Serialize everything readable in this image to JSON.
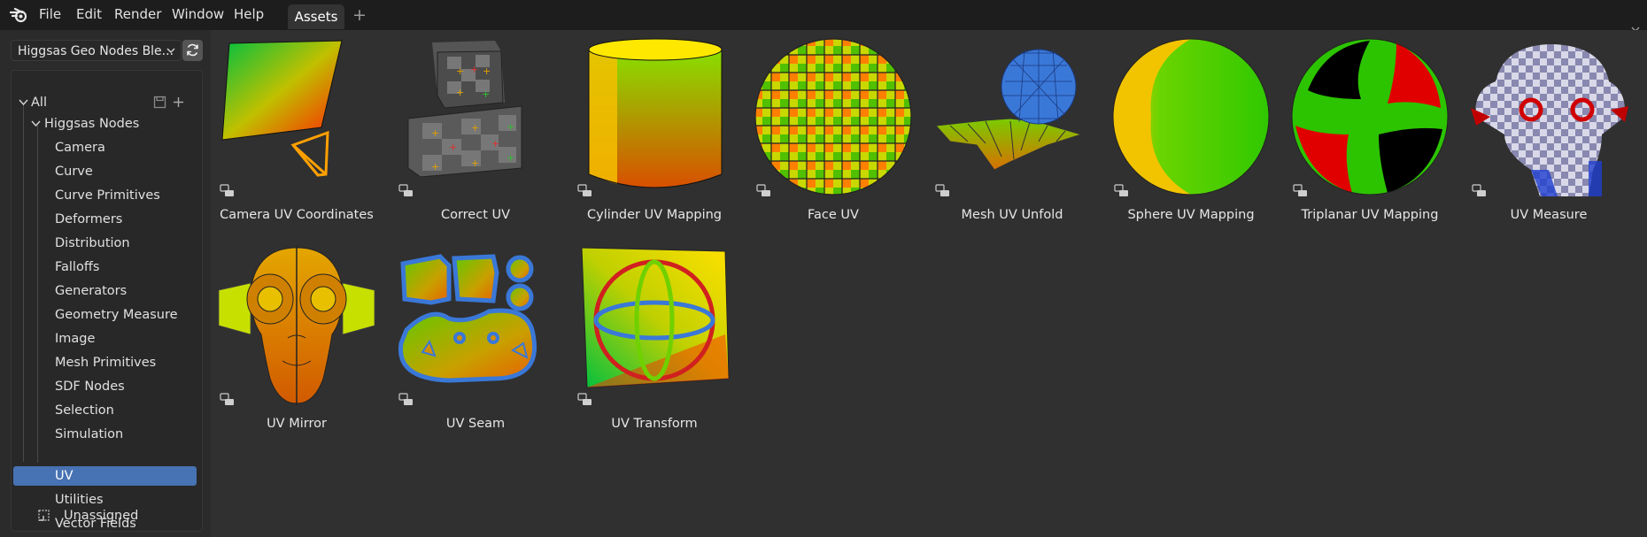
{
  "menubar": {
    "logo_icon": "blender-logo-icon",
    "items": [
      "File",
      "Edit",
      "Render",
      "Window",
      "Help"
    ],
    "tabs": [
      {
        "label": "Assets",
        "active": true
      }
    ],
    "add_tab_label": "+"
  },
  "sidebar": {
    "library_selector": {
      "value": "Higgsas Geo Nodes Ble..."
    },
    "refresh_icon": "refresh-icon",
    "tree": {
      "root": {
        "label": "All"
      },
      "group": {
        "label": "Higgsas Nodes"
      },
      "items": [
        {
          "label": "Camera"
        },
        {
          "label": "Curve"
        },
        {
          "label": "Curve Primitives"
        },
        {
          "label": "Deformers"
        },
        {
          "label": "Distribution"
        },
        {
          "label": "Falloffs"
        },
        {
          "label": "Generators"
        },
        {
          "label": "Geometry Measure"
        },
        {
          "label": "Image"
        },
        {
          "label": "Mesh Primitives"
        },
        {
          "label": "SDF Nodes"
        },
        {
          "label": "Selection"
        },
        {
          "label": "Simulation"
        },
        {
          "label": "UV",
          "selected": true
        },
        {
          "label": "Utilities"
        },
        {
          "label": "Vector Fields"
        }
      ],
      "unassigned": {
        "label": "Unassigned"
      }
    }
  },
  "assets": [
    {
      "label": "Camera UV Coordinates"
    },
    {
      "label": "Correct UV"
    },
    {
      "label": "Cylinder UV Mapping"
    },
    {
      "label": "Face UV"
    },
    {
      "label": "Mesh UV Unfold"
    },
    {
      "label": "Sphere UV Mapping"
    },
    {
      "label": "Triplanar UV Mapping"
    },
    {
      "label": "UV Measure"
    },
    {
      "label": "UV Mirror"
    },
    {
      "label": "UV Seam"
    },
    {
      "label": "UV Transform"
    }
  ],
  "colors": {
    "accent_selected": "#4772b3",
    "panel_bg": "#2b2b2b",
    "main_bg": "#303030",
    "topbar_bg": "#1d1d1d"
  }
}
